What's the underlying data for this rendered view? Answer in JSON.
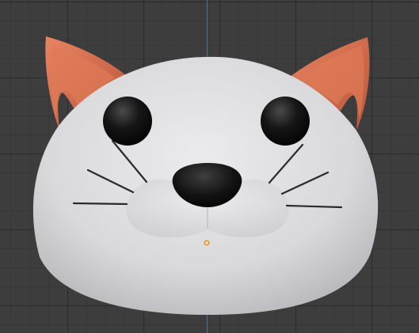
{
  "viewport": {
    "background_color": "#3d3d3d",
    "grid_color": "#2f2f2f",
    "axis_color": "#5a82be"
  },
  "model": {
    "head_color": "#dcdcde",
    "ear_color": "#d26a47",
    "ear_inner_color": "#e7805c",
    "eye_color": "#141414",
    "nose_color": "#141414",
    "whisker_color": "#2a2a2a",
    "origin_marker_color": "#e8901e"
  }
}
